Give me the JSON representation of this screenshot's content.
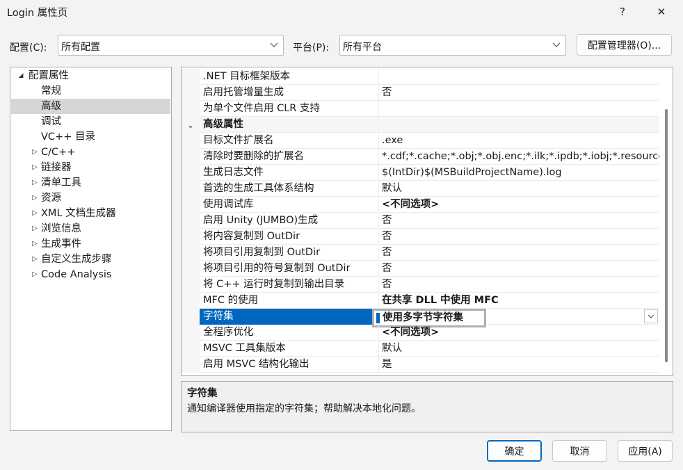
{
  "window": {
    "title": "Login 属性页",
    "help_glyph": "?",
    "close_glyph": "✕"
  },
  "config_bar": {
    "config_label": "配置(C):",
    "config_value": "所有配置",
    "platform_label": "平台(P):",
    "platform_value": "所有平台",
    "manager_button": "配置管理器(O)..."
  },
  "tree": {
    "root": {
      "label": "配置属性",
      "expander": "◢"
    },
    "items": [
      {
        "label": "常规"
      },
      {
        "label": "高级",
        "selected": true
      },
      {
        "label": "调试"
      },
      {
        "label": "VC++ 目录"
      },
      {
        "label": "C/C++",
        "expander": "▷"
      },
      {
        "label": "链接器",
        "expander": "▷"
      },
      {
        "label": "清单工具",
        "expander": "▷"
      },
      {
        "label": "资源",
        "expander": "▷"
      },
      {
        "label": "XML 文档生成器",
        "expander": "▷"
      },
      {
        "label": "浏览信息",
        "expander": "▷"
      },
      {
        "label": "生成事件",
        "expander": "▷"
      },
      {
        "label": "自定义生成步骤",
        "expander": "▷"
      },
      {
        "label": "Code Analysis",
        "expander": "▷"
      }
    ]
  },
  "grid": {
    "rows": [
      {
        "name": ".NET 目标框架版本",
        "value": ""
      },
      {
        "name": "启用托管增量生成",
        "value": "否"
      },
      {
        "name": "为单个文件启用 CLR 支持",
        "value": ""
      },
      {
        "name": "高级属性",
        "category": true,
        "expander": "⌄"
      },
      {
        "name": "目标文件扩展名",
        "value": ".exe"
      },
      {
        "name": "清除时要删除的扩展名",
        "value": "*.cdf;*.cache;*.obj;*.obj.enc;*.ilk;*.ipdb;*.iobj;*.resources;*.tlb;*.tli;*.tlh;*.tmp"
      },
      {
        "name": "生成日志文件",
        "value": "$(IntDir)$(MSBuildProjectName).log"
      },
      {
        "name": "首选的生成工具体系结构",
        "value": "默认"
      },
      {
        "name": "使用调试库",
        "value": "<不同选项>",
        "bold": true
      },
      {
        "name": "启用 Unity (JUMBO)生成",
        "value": "否"
      },
      {
        "name": "将内容复制到 OutDir",
        "value": "否"
      },
      {
        "name": "将项目引用复制到 OutDir",
        "value": "否"
      },
      {
        "name": "将项目引用的符号复制到 OutDir",
        "value": "否"
      },
      {
        "name": "将 C++ 运行时复制到输出目录",
        "value": "否"
      },
      {
        "name": "MFC 的使用",
        "value": "在共享 DLL 中使用 MFC",
        "bold": true
      },
      {
        "name": "字符集",
        "value": "使用多字节字符集",
        "bold": true,
        "selected": true
      },
      {
        "name": "全程序优化",
        "value": "<不同选项>",
        "bold": true
      },
      {
        "name": "MSVC 工具集版本",
        "value": "默认"
      },
      {
        "name": "启用 MSVC 结构化输出",
        "value": "是"
      }
    ]
  },
  "description": {
    "title": "字符集",
    "text": "通知编译器使用指定的字符集；帮助解决本地化问题。"
  },
  "buttons": {
    "ok": "确定",
    "cancel": "取消",
    "apply": "应用(A)"
  },
  "colors": {
    "selection": "#0067c0",
    "tree_selection": "#d6d6d6"
  }
}
